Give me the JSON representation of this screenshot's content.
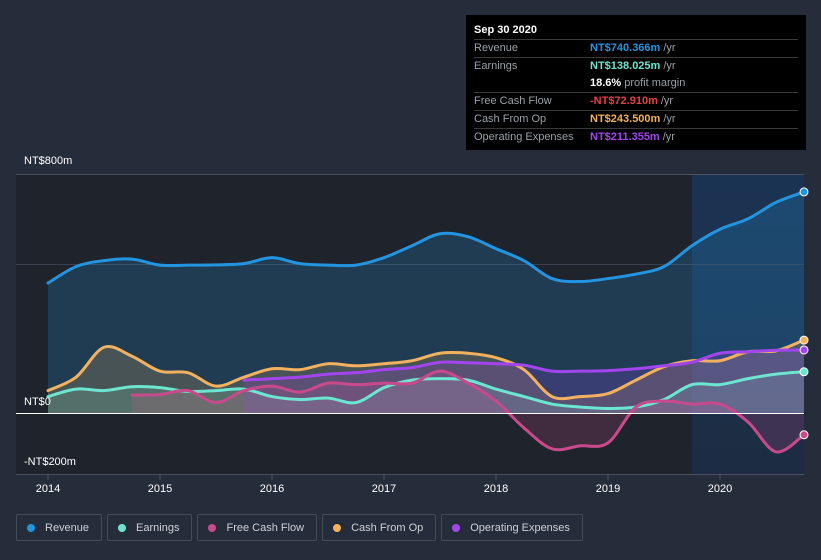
{
  "tooltip": {
    "date": "Sep 30 2020",
    "rows": [
      {
        "label": "Revenue",
        "value": "NT$740.366m",
        "unit": "/yr",
        "color": "#2394df"
      },
      {
        "label": "Earnings",
        "value": "NT$138.025m",
        "unit": "/yr",
        "color": "#6ce5d1"
      },
      {
        "label": "",
        "value": "18.6%",
        "unit": "profit margin",
        "color": "#ffffff"
      },
      {
        "label": "Free Cash Flow",
        "value": "-NT$72.910m",
        "unit": "/yr",
        "color": "#e64141"
      },
      {
        "label": "Cash From Op",
        "value": "NT$243.500m",
        "unit": "/yr",
        "color": "#f2b15f"
      },
      {
        "label": "Operating Expenses",
        "value": "NT$211.355m",
        "unit": "/yr",
        "color": "#a245ee"
      }
    ]
  },
  "legend": [
    {
      "label": "Revenue",
      "color": "#2394df"
    },
    {
      "label": "Earnings",
      "color": "#6ce5d1"
    },
    {
      "label": "Free Cash Flow",
      "color": "#c94a8c"
    },
    {
      "label": "Cash From Op",
      "color": "#f2b15f"
    },
    {
      "label": "Operating Expenses",
      "color": "#a245ee"
    }
  ],
  "chart_data": {
    "type": "area",
    "title": "",
    "xlabel": "",
    "ylabel": "",
    "y_tick_labels": [
      "NT$800m",
      "NT$0",
      "-NT$200m"
    ],
    "x_tick_labels": [
      "2014",
      "2015",
      "2016",
      "2017",
      "2018",
      "2019",
      "2020"
    ],
    "xlim": [
      2014,
      2020.75
    ],
    "ylim": [
      -200,
      800
    ],
    "highlight_from": 2019.75,
    "series": [
      {
        "name": "Revenue",
        "color": "#2394df",
        "x": [
          2014,
          2014.25,
          2014.5,
          2014.75,
          2015,
          2015.25,
          2015.5,
          2015.75,
          2016,
          2016.25,
          2016.5,
          2016.75,
          2017,
          2017.25,
          2017.5,
          2017.75,
          2018,
          2018.25,
          2018.5,
          2018.75,
          2019,
          2019.25,
          2019.5,
          2019.75,
          2020,
          2020.25,
          2020.5,
          2020.75
        ],
        "values": [
          435,
          490,
          510,
          515,
          495,
          495,
          496,
          500,
          520,
          500,
          495,
          495,
          520,
          560,
          600,
          590,
          550,
          510,
          450,
          440,
          450,
          465,
          490,
          560,
          615,
          650,
          705,
          740
        ]
      },
      {
        "name": "Earnings",
        "color": "#6ce5d1",
        "x": [
          2014,
          2014.25,
          2014.5,
          2014.75,
          2015,
          2015.25,
          2015.5,
          2015.75,
          2016,
          2016.25,
          2016.5,
          2016.75,
          2017,
          2017.25,
          2017.5,
          2017.75,
          2018,
          2018.25,
          2018.5,
          2018.75,
          2019,
          2019.25,
          2019.5,
          2019.75,
          2020,
          2020.25,
          2020.5,
          2020.75
        ],
        "values": [
          55,
          80,
          75,
          88,
          85,
          72,
          75,
          80,
          55,
          45,
          50,
          35,
          85,
          110,
          115,
          110,
          80,
          55,
          30,
          20,
          15,
          20,
          45,
          95,
          95,
          115,
          130,
          138
        ]
      },
      {
        "name": "Free Cash Flow",
        "color": "#c94a8c",
        "x": [
          2014.75,
          2015,
          2015.25,
          2015.5,
          2015.75,
          2016,
          2016.25,
          2016.5,
          2016.75,
          2017,
          2017.25,
          2017.5,
          2017.75,
          2018,
          2018.25,
          2018.5,
          2018.75,
          2019,
          2019.25,
          2019.5,
          2019.75,
          2020,
          2020.25,
          2020.5,
          2020.75
        ],
        "values": [
          60,
          62,
          75,
          35,
          75,
          90,
          70,
          100,
          95,
          100,
          100,
          140,
          100,
          40,
          -50,
          -120,
          -110,
          -100,
          20,
          40,
          30,
          30,
          -30,
          -130,
          -73
        ]
      },
      {
        "name": "Cash From Op",
        "color": "#f2b15f",
        "x": [
          2014,
          2014.25,
          2014.5,
          2014.75,
          2015,
          2015.25,
          2015.5,
          2015.75,
          2016,
          2016.25,
          2016.5,
          2016.75,
          2017,
          2017.25,
          2017.5,
          2017.75,
          2018,
          2018.25,
          2018.5,
          2018.75,
          2019,
          2019.25,
          2019.5,
          2019.75,
          2020,
          2020.25,
          2020.5,
          2020.75
        ],
        "values": [
          75,
          120,
          220,
          190,
          140,
          135,
          90,
          120,
          148,
          145,
          165,
          158,
          165,
          175,
          200,
          200,
          185,
          145,
          55,
          55,
          65,
          110,
          155,
          175,
          175,
          205,
          208,
          244
        ]
      },
      {
        "name": "Operating Expenses",
        "color": "#a245ee",
        "x": [
          2015.75,
          2016,
          2016.25,
          2016.5,
          2016.75,
          2017,
          2017.25,
          2017.5,
          2017.75,
          2018,
          2018.25,
          2018.5,
          2018.75,
          2019,
          2019.25,
          2019.5,
          2019.75,
          2020,
          2020.25,
          2020.5,
          2020.75
        ],
        "values": [
          110,
          115,
          120,
          130,
          135,
          145,
          152,
          170,
          168,
          165,
          160,
          140,
          140,
          142,
          148,
          158,
          170,
          200,
          205,
          210,
          211
        ]
      }
    ]
  }
}
